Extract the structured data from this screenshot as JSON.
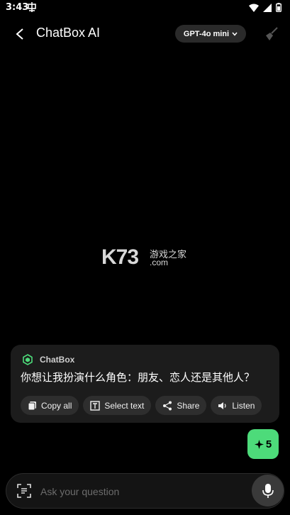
{
  "status_bar": {
    "time": "3:43"
  },
  "header": {
    "title": "ChatBox AI",
    "model_selector": "GPT-4o mini"
  },
  "watermark": {
    "logo_text": "K73",
    "cn_text": "游戏之家",
    "domain": ".com"
  },
  "message": {
    "sender": "ChatBox",
    "text": "你想让我扮演什么角色：朋友、恋人还是其他人？",
    "actions": [
      {
        "label": "Copy all",
        "icon": "copy-icon"
      },
      {
        "label": "Select text",
        "icon": "text-select-icon"
      },
      {
        "label": "Share",
        "icon": "share-icon"
      },
      {
        "label": "Listen",
        "icon": "speaker-icon"
      }
    ]
  },
  "credits_button": {
    "count": "5"
  },
  "input": {
    "placeholder": "Ask your question"
  },
  "colors": {
    "accent_green": "#4ddb7a",
    "background": "#000000",
    "card": "#1c1c1c"
  }
}
